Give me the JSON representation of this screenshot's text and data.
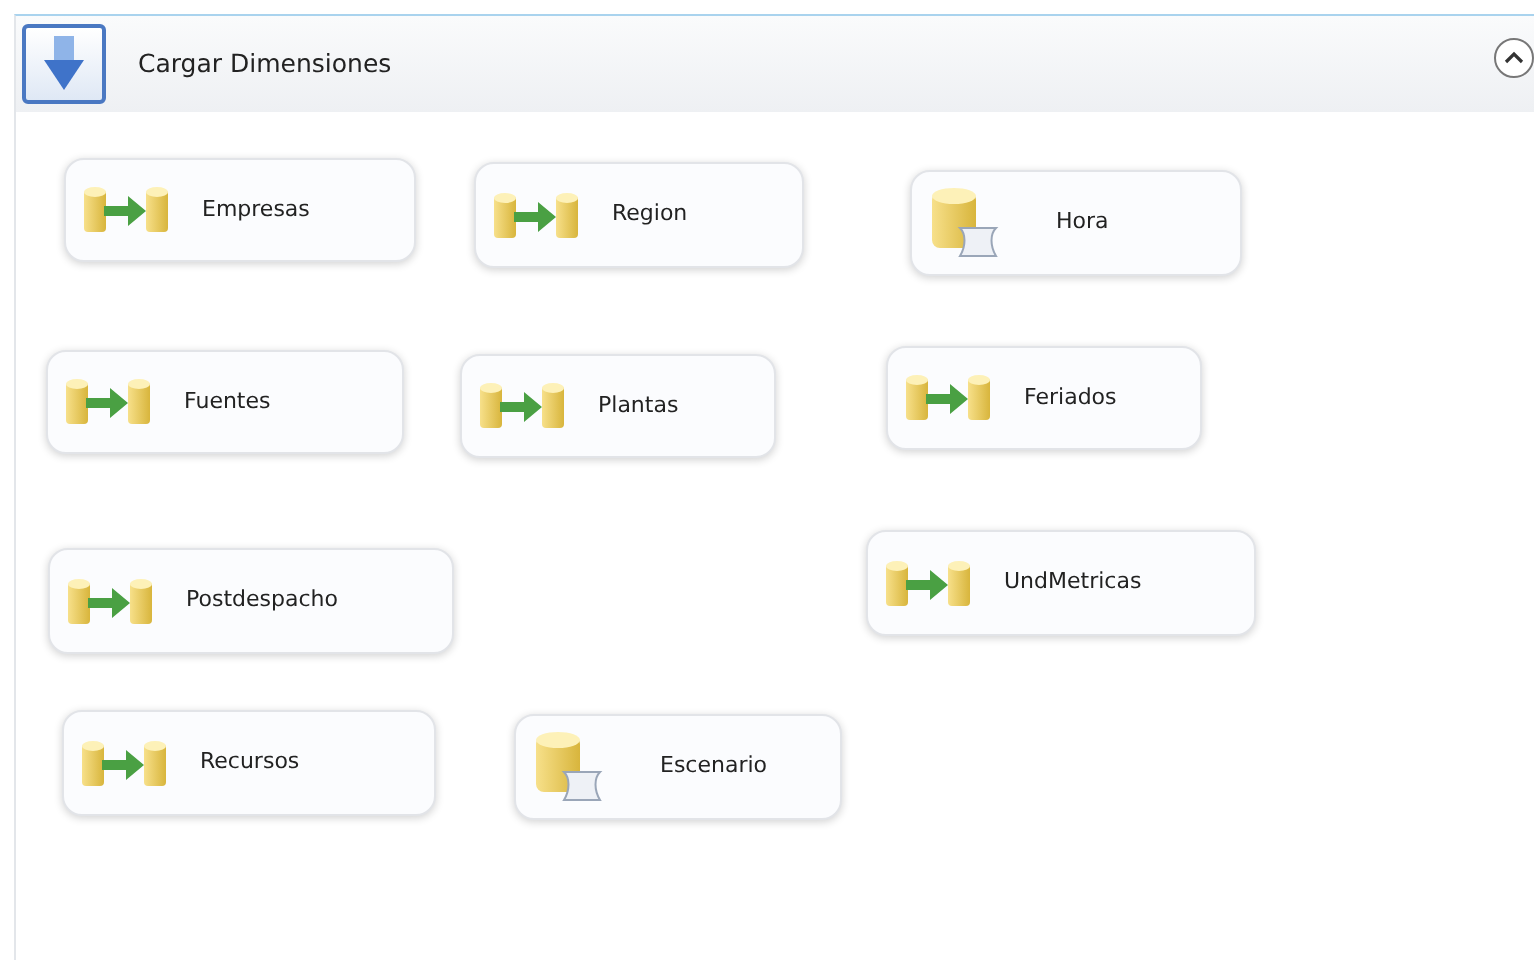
{
  "container": {
    "title": "Cargar Dimensiones",
    "expanded": true
  },
  "tasks": [
    {
      "kind": "dataflow",
      "label": "Empresas"
    },
    {
      "kind": "dataflow",
      "label": "Region"
    },
    {
      "kind": "sql",
      "label": "Hora"
    },
    {
      "kind": "dataflow",
      "label": "Fuentes"
    },
    {
      "kind": "dataflow",
      "label": "Plantas"
    },
    {
      "kind": "dataflow",
      "label": "Feriados"
    },
    {
      "kind": "dataflow",
      "label": "Postdespacho"
    },
    {
      "kind": "dataflow",
      "label": "UndMetricas"
    },
    {
      "kind": "dataflow",
      "label": "Recursos"
    },
    {
      "kind": "sql",
      "label": "Escenario"
    }
  ]
}
